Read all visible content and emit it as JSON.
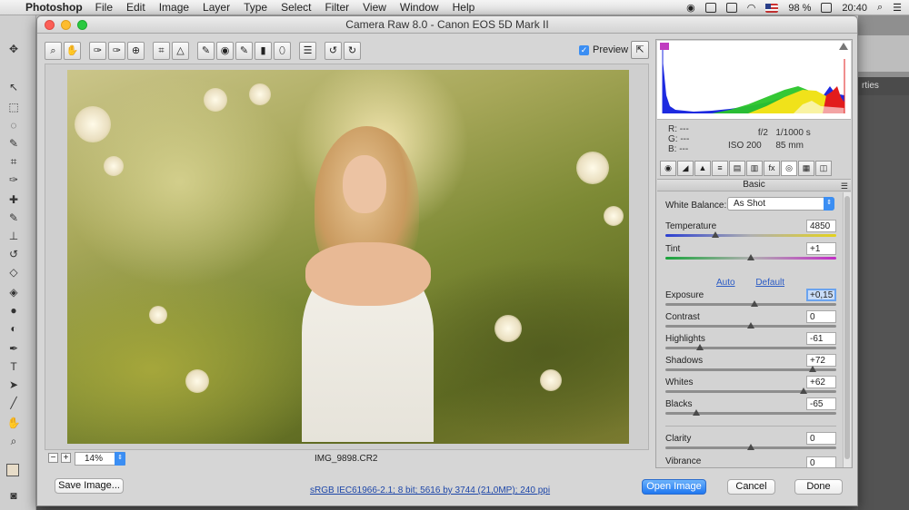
{
  "menubar": {
    "app_name": "Photoshop",
    "items": [
      "File",
      "Edit",
      "Image",
      "Layer",
      "Type",
      "Select",
      "Filter",
      "View",
      "Window",
      "Help"
    ],
    "battery": "98 %",
    "time": "20:40"
  },
  "photoshop": {
    "panel_tab": "rties"
  },
  "window": {
    "title": "Camera Raw 8.0  -  Canon EOS 5D Mark II"
  },
  "toolbar": {
    "tools": [
      "zoom-tool",
      "hand-tool",
      "white-balance-tool",
      "color-sampler-tool",
      "targeted-adjustment-tool",
      "crop-tool",
      "straighten-tool",
      "spot-removal-tool",
      "red-eye-tool",
      "adjustment-brush-tool",
      "graduated-filter-tool",
      "radial-filter-tool",
      "preferences",
      "rotate-ccw",
      "rotate-cw"
    ],
    "preview_label": "Preview",
    "preview_checked": true
  },
  "image": {
    "zoom": "14%",
    "filename": "IMG_9898.CR2"
  },
  "histogram": {
    "colors": {
      "red": "#e21c1c",
      "green": "#2ac52a",
      "blue": "#1d2ae0",
      "yellow": "#f0e21a"
    }
  },
  "info": {
    "r": "R:   ---",
    "g": "G:   ---",
    "b": "B:   ---",
    "aperture": "f/2",
    "shutter": "1/1000 s",
    "iso": "ISO 200",
    "focal": "85 mm"
  },
  "panel": {
    "title": "Basic",
    "tab_icons": [
      "basic-tab-icon",
      "tone-curve-tab-icon",
      "detail-tab-icon",
      "hsl-tab-icon",
      "split-toning-tab-icon",
      "lens-corrections-tab-icon",
      "effects-tab-icon",
      "camera-calibration-tab-icon",
      "presets-tab-icon",
      "snapshots-tab-icon"
    ],
    "white_balance": {
      "label": "White Balance:",
      "value": "As Shot"
    },
    "auto": "Auto",
    "default": "Default",
    "sliders": {
      "temperature": {
        "label": "Temperature",
        "value": "4850",
        "pos": 0.29
      },
      "tint": {
        "label": "Tint",
        "value": "+1",
        "pos": 0.5
      },
      "exposure": {
        "label": "Exposure",
        "value": "+0,15",
        "pos": 0.52
      },
      "contrast": {
        "label": "Contrast",
        "value": "0",
        "pos": 0.5
      },
      "highlights": {
        "label": "Highlights",
        "value": "-61",
        "pos": 0.2
      },
      "shadows": {
        "label": "Shadows",
        "value": "+72",
        "pos": 0.86
      },
      "whites": {
        "label": "Whites",
        "value": "+62",
        "pos": 0.81
      },
      "blacks": {
        "label": "Blacks",
        "value": "-65",
        "pos": 0.18
      },
      "clarity": {
        "label": "Clarity",
        "value": "0",
        "pos": 0.5
      },
      "vibrance": {
        "label": "Vibrance",
        "value": "0",
        "pos": 0.5
      }
    }
  },
  "bottom": {
    "save_image": "Save Image...",
    "workflow": "sRGB IEC61966-2.1; 8 bit; 5616 by 3744 (21,0MP); 240 ppi",
    "open_image": "Open Image",
    "cancel": "Cancel",
    "done": "Done"
  }
}
